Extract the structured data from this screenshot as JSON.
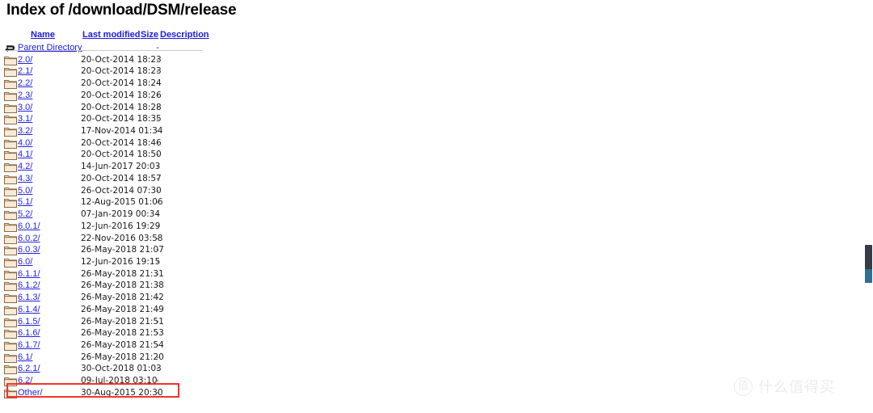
{
  "page": {
    "title": "Index of /download/DSM/release"
  },
  "table": {
    "headers": [
      {
        "label": "Name",
        "name": "name"
      },
      {
        "label": "Last modified",
        "name": "last-modified"
      },
      {
        "label": "Size",
        "name": "size"
      },
      {
        "label": "Description",
        "name": "description"
      }
    ],
    "parent": {
      "label": "Parent Directory",
      "icon": "back-arrow-icon",
      "date": "",
      "size": "-"
    },
    "rows": [
      {
        "name": "2.0/",
        "icon": "folder-icon",
        "date": "20-Oct-2014 18:23",
        "size": "-"
      },
      {
        "name": "2.1/",
        "icon": "folder-icon",
        "date": "20-Oct-2014 18:23",
        "size": "-"
      },
      {
        "name": "2.2/",
        "icon": "folder-icon",
        "date": "20-Oct-2014 18:24",
        "size": "-"
      },
      {
        "name": "2.3/",
        "icon": "folder-icon",
        "date": "20-Oct-2014 18:26",
        "size": "-"
      },
      {
        "name": "3.0/",
        "icon": "folder-icon",
        "date": "20-Oct-2014 18:28",
        "size": "-"
      },
      {
        "name": "3.1/",
        "icon": "folder-icon",
        "date": "20-Oct-2014 18:35",
        "size": "-"
      },
      {
        "name": "3.2/",
        "icon": "folder-icon",
        "date": "17-Nov-2014 01:34",
        "size": "-"
      },
      {
        "name": "4.0/",
        "icon": "folder-icon",
        "date": "20-Oct-2014 18:46",
        "size": "-"
      },
      {
        "name": "4.1/",
        "icon": "folder-icon",
        "date": "20-Oct-2014 18:50",
        "size": "-"
      },
      {
        "name": "4.2/",
        "icon": "folder-icon",
        "date": "14-Jun-2017 20:03",
        "size": "-"
      },
      {
        "name": "4.3/",
        "icon": "folder-icon",
        "date": "20-Oct-2014 18:57",
        "size": "-"
      },
      {
        "name": "5.0/",
        "icon": "folder-icon",
        "date": "26-Oct-2014 07:30",
        "size": "-"
      },
      {
        "name": "5.1/",
        "icon": "folder-icon",
        "date": "12-Aug-2015 01:06",
        "size": "-"
      },
      {
        "name": "5.2/",
        "icon": "folder-icon",
        "date": "07-Jan-2019 00:34",
        "size": "-"
      },
      {
        "name": "6.0.1/",
        "icon": "folder-icon",
        "date": "12-Jun-2016 19:29",
        "size": "-"
      },
      {
        "name": "6.0.2/",
        "icon": "folder-icon",
        "date": "22-Nov-2016 03:58",
        "size": "-"
      },
      {
        "name": "6.0.3/",
        "icon": "folder-icon",
        "date": "26-May-2018 21:07",
        "size": "-"
      },
      {
        "name": "6.0/",
        "icon": "folder-icon",
        "date": "12-Jun-2016 19:15",
        "size": "-"
      },
      {
        "name": "6.1.1/",
        "icon": "folder-icon",
        "date": "26-May-2018 21:31",
        "size": "-"
      },
      {
        "name": "6.1.2/",
        "icon": "folder-icon",
        "date": "26-May-2018 21:38",
        "size": "-"
      },
      {
        "name": "6.1.3/",
        "icon": "folder-icon",
        "date": "26-May-2018 21:42",
        "size": "-"
      },
      {
        "name": "6.1.4/",
        "icon": "folder-icon",
        "date": "26-May-2018 21:49",
        "size": "-"
      },
      {
        "name": "6.1.5/",
        "icon": "folder-icon",
        "date": "26-May-2018 21:51",
        "size": "-"
      },
      {
        "name": "6.1.6/",
        "icon": "folder-icon",
        "date": "26-May-2018 21:53",
        "size": "-"
      },
      {
        "name": "6.1.7/",
        "icon": "folder-icon",
        "date": "26-May-2018 21:54",
        "size": "-"
      },
      {
        "name": "6.1/",
        "icon": "folder-icon",
        "date": "26-May-2018 21:20",
        "size": "-"
      },
      {
        "name": "6.2.1/",
        "icon": "folder-icon",
        "date": "30-Oct-2018 01:03",
        "size": "-"
      },
      {
        "name": "6.2/",
        "icon": "folder-icon",
        "date": "09-Jul-2018 03:10",
        "size": "-",
        "highlighted": true
      },
      {
        "name": "Other/",
        "icon": "folder-icon",
        "date": "30-Aug-2015 20:30",
        "size": "-"
      }
    ]
  },
  "annotation": {
    "highlight_color": "#f5332b",
    "highlight_target": "6.2/"
  },
  "scrollbar": {
    "thumb_color": "#363c45",
    "accent_color": "#2f6f94"
  },
  "watermark": {
    "mark": "值",
    "text": "什么值得买",
    "color": "#ececed"
  }
}
